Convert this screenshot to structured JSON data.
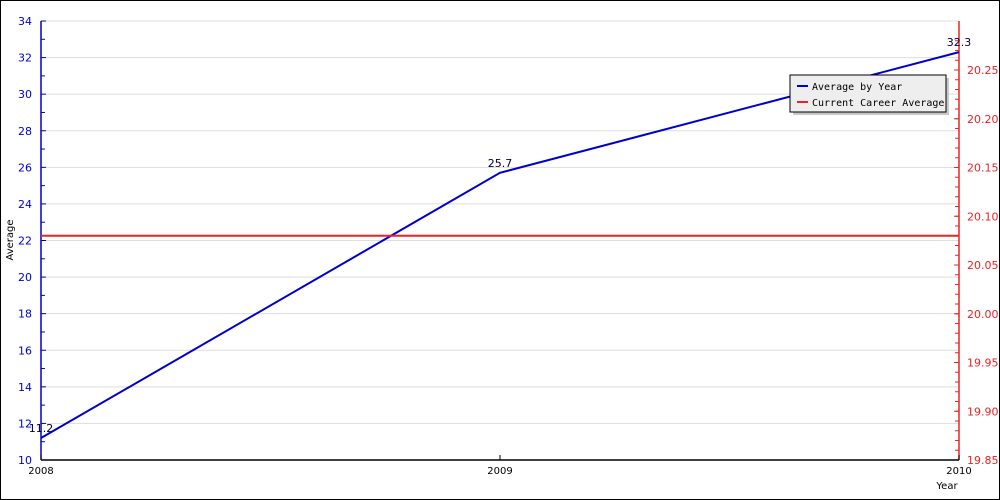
{
  "chart_data": {
    "type": "line",
    "title": "",
    "xlabel": "Year",
    "ylabel": "Average",
    "categories": [
      "2008",
      "2009",
      "2010"
    ],
    "series": [
      {
        "name": "Average by Year",
        "axis": "left",
        "color": "#0000cc",
        "values": [
          11.2,
          25.7,
          32.3
        ],
        "labels": [
          "11.2",
          "25.7",
          "32.3"
        ]
      },
      {
        "name": "Current Career Average",
        "axis": "right",
        "color": "#ee2222",
        "values": [
          20.08,
          20.08,
          20.08
        ]
      }
    ],
    "ylim": [
      10,
      34
    ],
    "y_ticks": [
      10,
      12,
      14,
      16,
      18,
      20,
      22,
      24,
      26,
      28,
      30,
      32,
      34
    ],
    "y2lim": [
      19.85,
      20.25
    ],
    "y2_ticks": [
      "19.85",
      "19.90",
      "19.95",
      "20.00",
      "20.05",
      "20.10",
      "20.15",
      "20.20",
      "20.25"
    ],
    "grid": true,
    "legend_position": "top-right"
  }
}
